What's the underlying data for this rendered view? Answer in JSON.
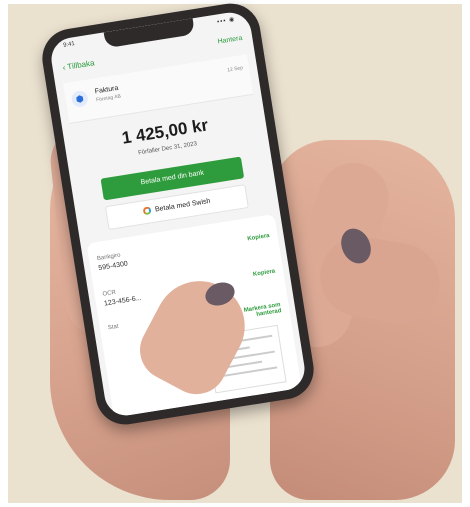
{
  "status": {
    "time": "9:41",
    "signal": "▪▪▪ ◉"
  },
  "nav": {
    "back_label": "Tillbaka",
    "manage_label": "Hantera"
  },
  "invoice": {
    "icon": "shield-icon",
    "title": "Faktura",
    "subtitle": "Företag AB",
    "date": "12 Sep"
  },
  "amount": "1 425,00 kr",
  "due": "Förfaller Dec 31, 2023",
  "buttons": {
    "bank_label": "Betala med din bank",
    "swish_label": "Betala med Swish"
  },
  "details": [
    {
      "label": "Bankgiro",
      "value": "595-4300",
      "action": "Kopiera"
    },
    {
      "label": "OCR",
      "value": "123-456-6...",
      "action": "Kopiera"
    },
    {
      "label": "Stat",
      "value": "",
      "action": "Markera som hanterad"
    }
  ],
  "colors": {
    "accent": "#2e9c3c",
    "background": "#ebe1cf",
    "phone": "#2f2a2a"
  }
}
